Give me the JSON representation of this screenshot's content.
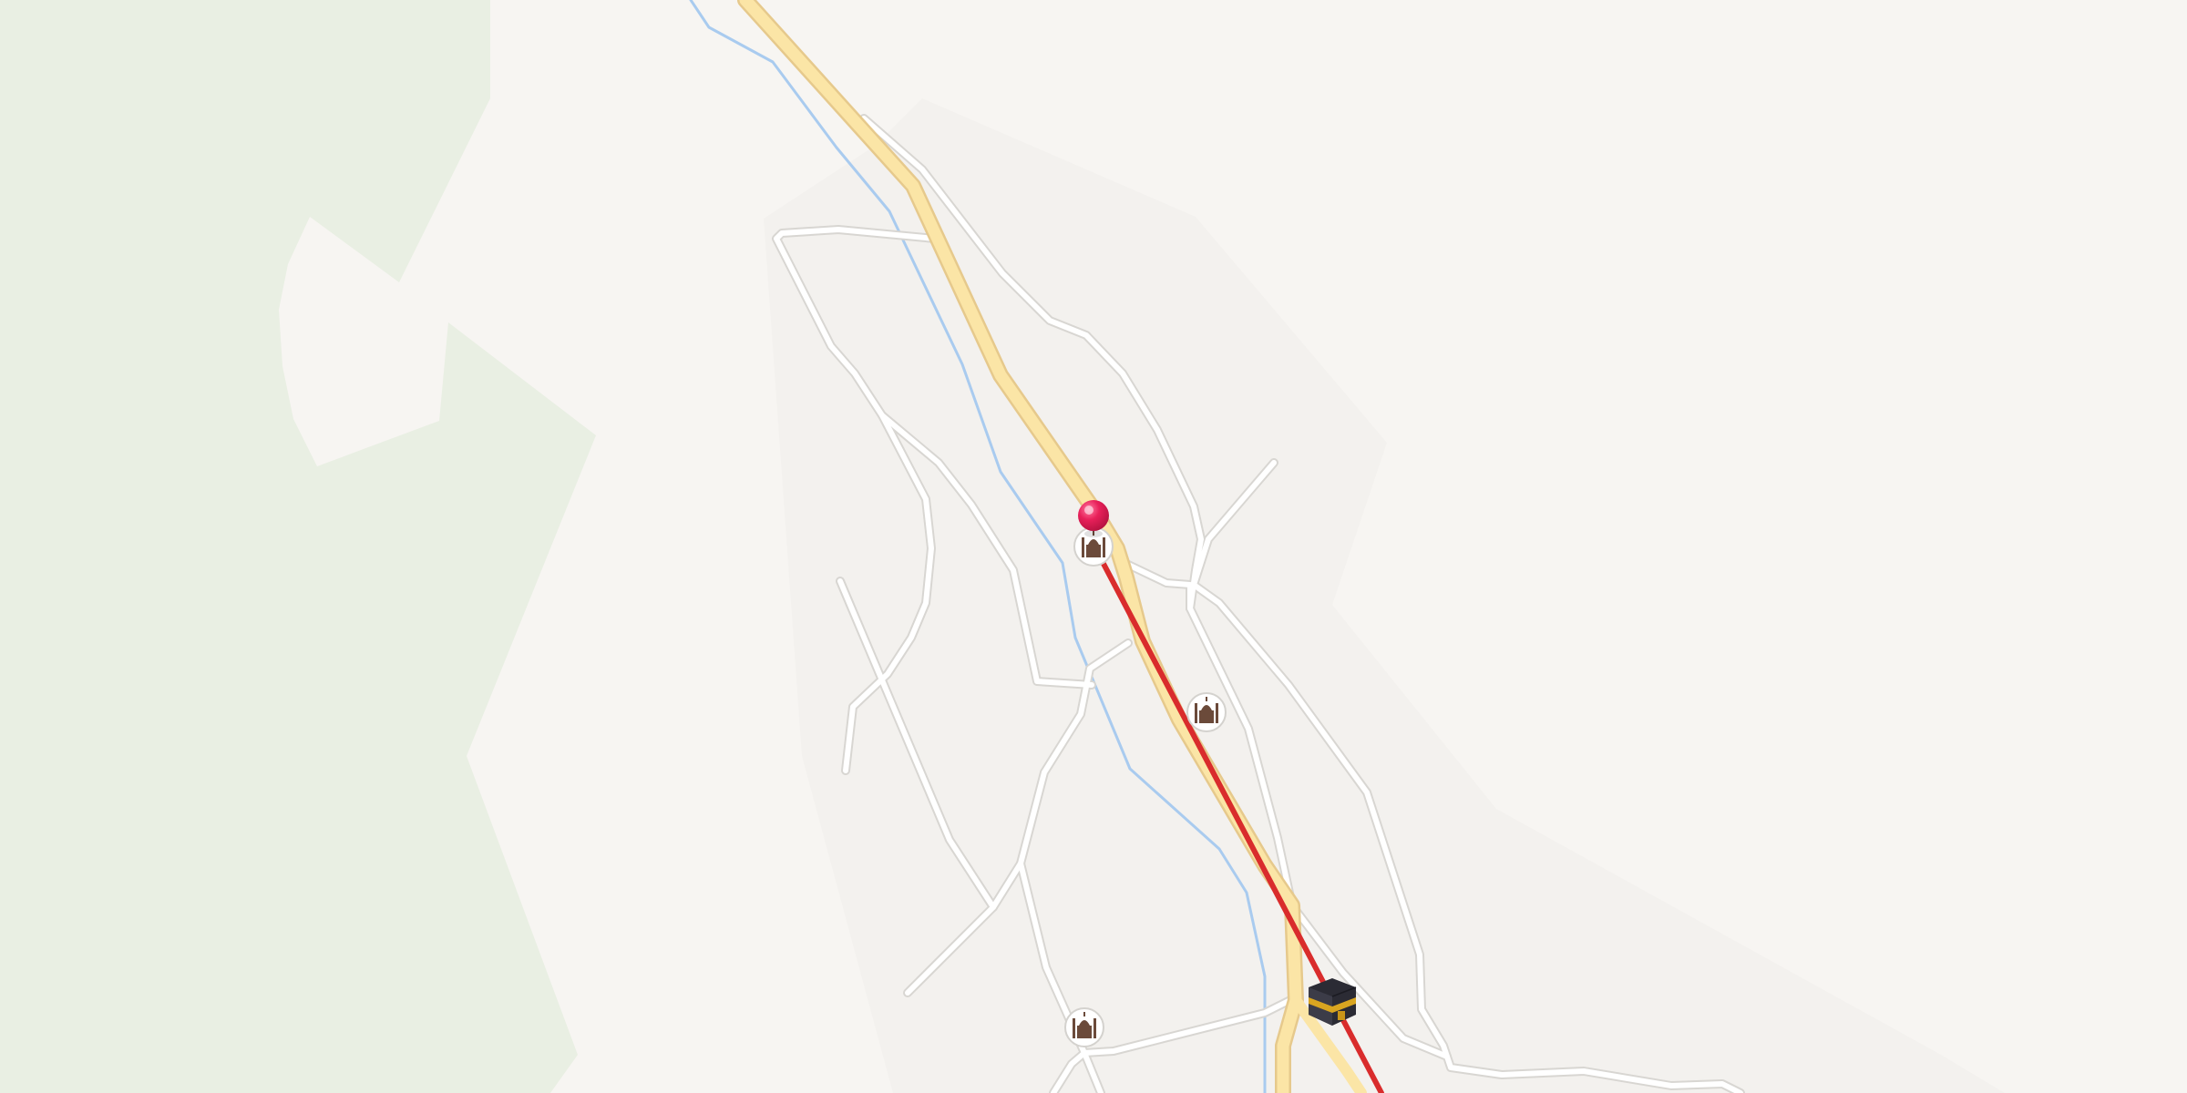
{
  "map": {
    "colors": {
      "background": "#f7f5f2",
      "vegetation": "#e9efe3",
      "landuse": "#f3f1ee",
      "road": "#ffffff",
      "primary_road": "#fbe5a6",
      "waterway": "#a9cbef",
      "route_line": "#d92c2c",
      "pin": "#e8205a"
    },
    "markers": [
      {
        "type": "location-pin",
        "icon": "red-pin-icon"
      },
      {
        "type": "mosque",
        "icon": "mosque-icon"
      },
      {
        "type": "mosque",
        "icon": "mosque-icon"
      },
      {
        "type": "mosque",
        "icon": "mosque-icon"
      },
      {
        "type": "kaaba-destination",
        "icon": "kaaba-icon"
      }
    ]
  }
}
